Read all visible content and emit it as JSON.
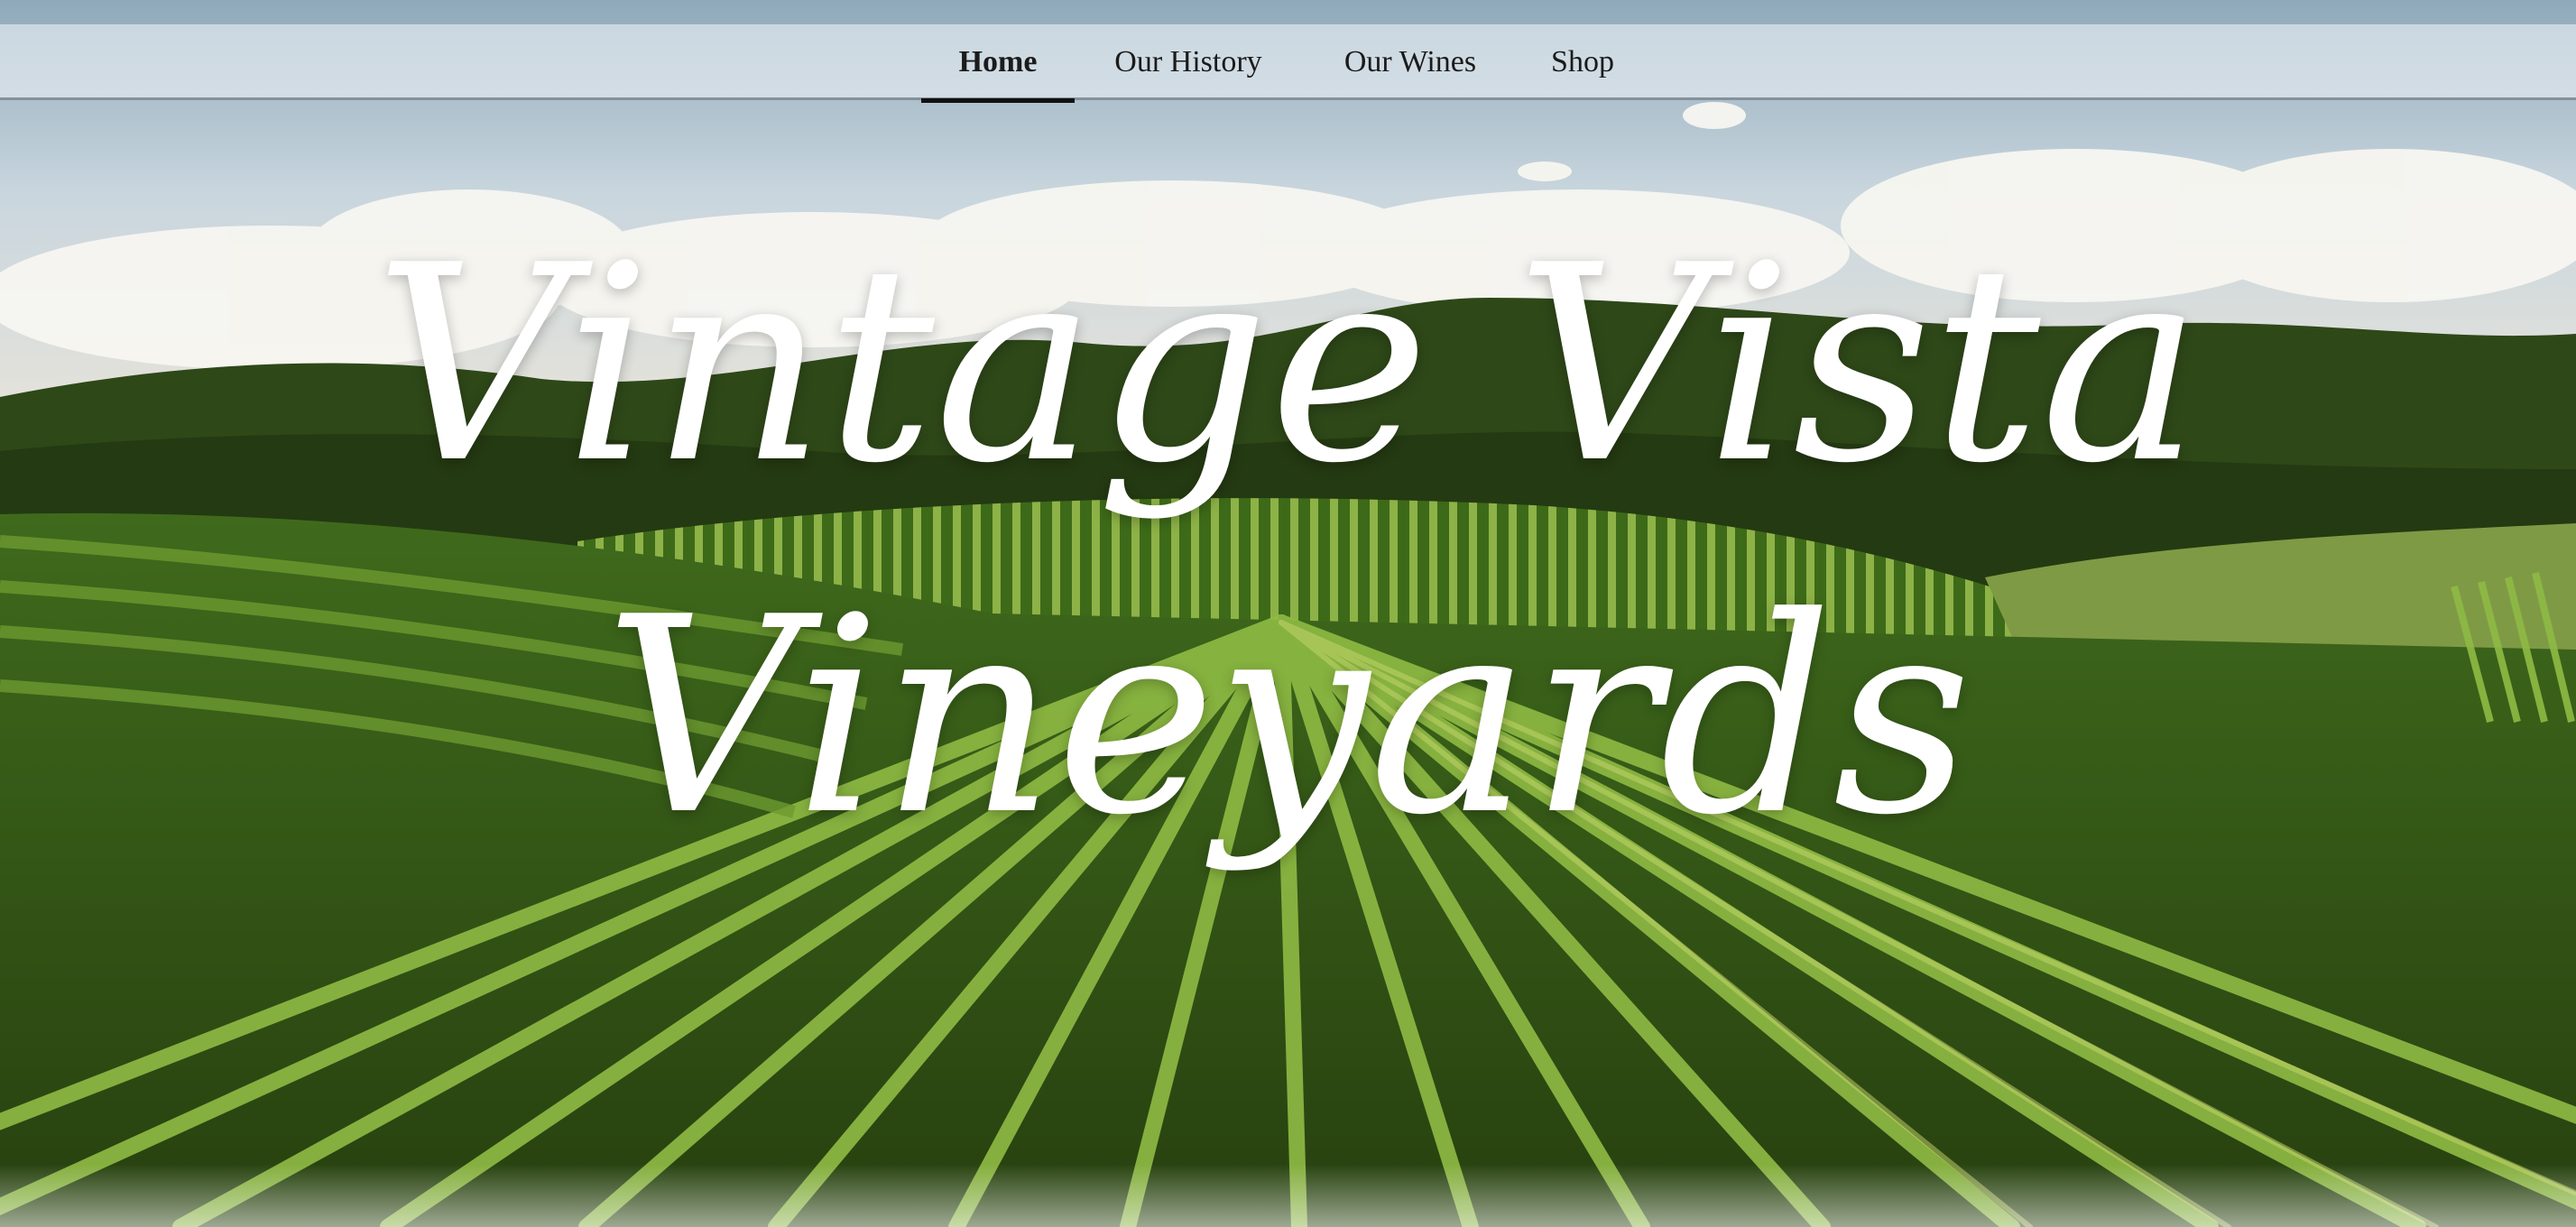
{
  "nav": {
    "items": [
      {
        "label": "Home",
        "active": true
      },
      {
        "label": "Our History",
        "active": false
      },
      {
        "label": "Our Wines",
        "active": false
      },
      {
        "label": "Shop",
        "active": false
      }
    ]
  },
  "hero": {
    "title_line_1": "Vintage Vista",
    "title_line_2": "Vineyards",
    "background": "vineyard-hills-photo"
  },
  "colors": {
    "nav_text": "#1b1b1b",
    "active_underline": "#111111",
    "title_text": "#ffffff",
    "vine_green": "#4e7a22"
  }
}
